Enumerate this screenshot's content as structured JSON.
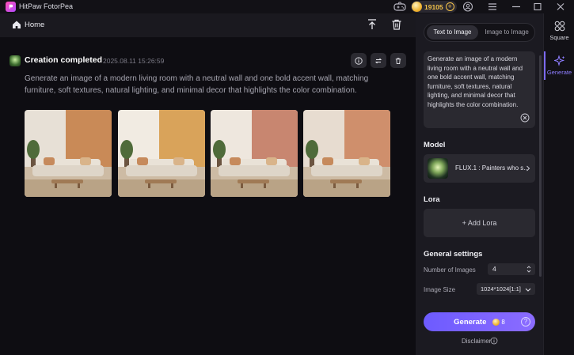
{
  "app": {
    "title": "HitPaw FotorPea",
    "coins": "19105",
    "coin_plus": "+"
  },
  "homebar": {
    "home_label": "Home"
  },
  "creation": {
    "status_title": "Creation completed",
    "datetime": "2025.08.11  15:26:59",
    "prompt": "Generate an image of a modern living room with a neutral wall and one bold accent wall, matching furniture, soft textures, natural lighting, and minimal decor that highlights the color combination.",
    "images": [
      {
        "name": "living-room-1",
        "wall_left": "#e7e0d6",
        "wall_accent": "#c98a57"
      },
      {
        "name": "living-room-2",
        "wall_left": "#f1ebe2",
        "wall_accent": "#d9a35a"
      },
      {
        "name": "living-room-3",
        "wall_left": "#eee7de",
        "wall_accent": "#c88670"
      },
      {
        "name": "living-room-4",
        "wall_left": "#e7dcd0",
        "wall_accent": "#cf8f6c"
      }
    ]
  },
  "panel": {
    "tabs": [
      "Text to Image",
      "Image to Image"
    ],
    "prompt_text": "Generate an image of a modern living room with a neutral wall and one bold accent wall, matching furniture, soft textures, natural lighting, and minimal decor that highlights the color combination.",
    "model_label": "Model",
    "model_name": "FLUX.1 : Painters who s...",
    "lora_label": "Lora",
    "add_lora": "+ Add Lora",
    "general_settings_label": "General settings",
    "number_of_images_label": "Number of Images",
    "number_of_images_value": "4",
    "image_size_label": "Image Size",
    "image_size_value": "1024*1024[1:1]",
    "generate_label": "Generate",
    "generate_cost": "8",
    "generate_help": "?",
    "disclaimer": "Disclaimer"
  },
  "sidenav": {
    "items": [
      {
        "label": "Square"
      },
      {
        "label": "Generate"
      }
    ]
  },
  "colors": {
    "accent": "#7d6bff",
    "coin": "#f3c24a"
  }
}
